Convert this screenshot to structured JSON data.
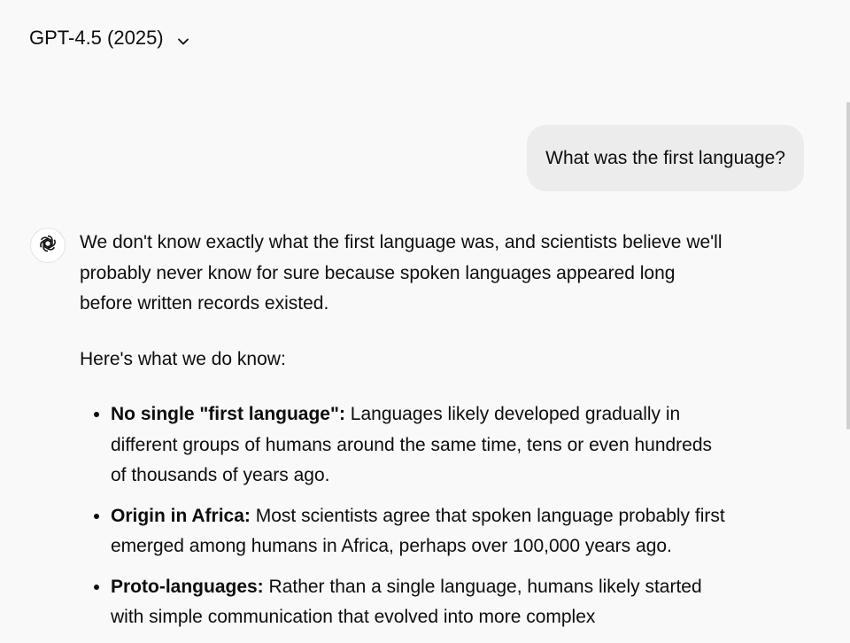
{
  "header": {
    "model_label": "GPT-4.5 (2025)",
    "chevron_icon": "chevron-down-icon"
  },
  "user_message": {
    "text": "What was the first language?"
  },
  "assistant": {
    "avatar_icon": "openai-logo-icon",
    "intro": "We don't know exactly what the first language was, and scientists believe we'll probably never know for sure because spoken languages appeared long before written records existed.",
    "lead": "Here's what we do know:",
    "bullets": [
      {
        "title": "No single \"first language\":",
        "text": " Languages likely developed gradually in different groups of humans around the same time, tens or even hundreds of thousands of years ago."
      },
      {
        "title": "Origin in Africa:",
        "text": " Most scientists agree that spoken language probably first emerged among humans in Africa, perhaps over 100,000 years ago."
      },
      {
        "title": "Proto-languages:",
        "text": " Rather than a single language, humans likely started with simple communication that evolved into more complex"
      }
    ]
  },
  "colors": {
    "background": "#f9f9f9",
    "user_bubble": "#ececec",
    "text": "#0d0d0d"
  }
}
